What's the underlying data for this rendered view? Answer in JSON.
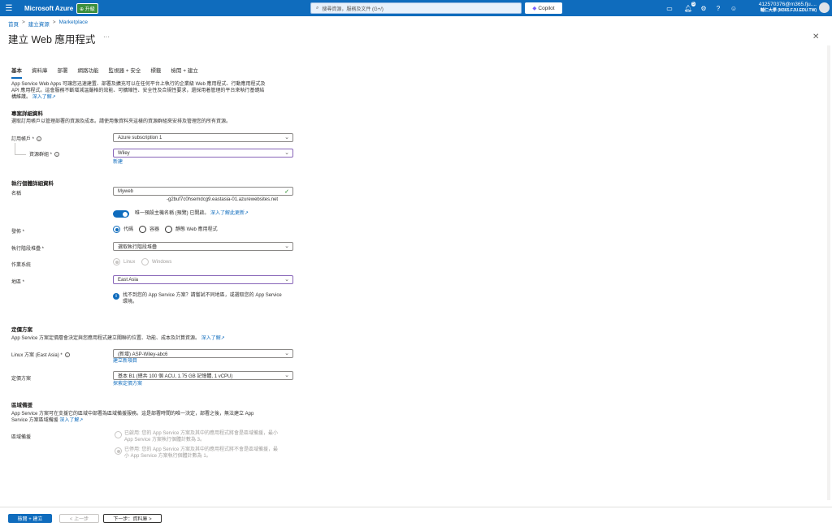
{
  "topbar": {
    "brand": "Microsoft Azure",
    "upgrade": "升級",
    "search_placeholder": "搜尋資源，服務及文件 (G+/)",
    "copilot": "Copilot",
    "notification_count": "5",
    "user_name": "412570376@m365.fju....",
    "user_org": "輔仁大學 (M365.FJU.EDU.TW)"
  },
  "breadcrumb": [
    "首頁",
    "建立資源",
    "Marketplace"
  ],
  "page": {
    "title": "建立 Web 應用程式",
    "more": "···"
  },
  "tabs": [
    "基本",
    "資料庫",
    "部署",
    "網路功能",
    "監視器 + 安全",
    "標籤",
    "檢閱 + 建立"
  ],
  "intro": {
    "line1": "App Service Web Apps 可讓您迅速建置、部署及擴充可以在任何平台上執行的企業級 Web 應用程式、行動應用程式及",
    "line2": "API 應用程式。這會服務不斷增減溫嚴格的效能、可擴縮性、安全性及合規性要求，還採用着管理的平台來執行基礎結",
    "line3": "構維護。",
    "link": "深入了解"
  },
  "project": {
    "heading": "專案詳細資料",
    "desc": "選取訂用帳戶以管理部署的資源及成本。請使用像資料夾這樣的資源群組來安排及管理您的所有資源。",
    "subscription_label": "訂用帳戶 *",
    "subscription_value": "Azure subscription 1",
    "rg_label": "資源群組 *",
    "rg_value": "Wiley",
    "rg_new": "新建"
  },
  "instance": {
    "heading": "執行個體詳細資料",
    "name_label": "名稱",
    "name_value": "Myweb",
    "domain_suffix": "-g2buf7c0hsemdcg9.eastasia-01.azurewebsites.net",
    "unique_host_text": "唯一預設主機名稱 (預覽) 已開啟。",
    "unique_host_link": "深入了解此更新",
    "publish_label": "發佈 *",
    "publish_options": [
      "代碼",
      "容器",
      "靜態 Web 應用程式"
    ],
    "runtime_label": "執行階段堆疊 *",
    "runtime_value": "選取執行階段堆疊",
    "os_label": "作業系統",
    "os_options": [
      "Linux",
      "Windows"
    ],
    "region_label": "地區 *",
    "region_value": "East Asia",
    "region_info_1": "找不到您的 App Service 方案？請嘗試不同地區，或選取您的 App Service",
    "region_info_2": "環境。"
  },
  "pricing": {
    "heading": "定價方案",
    "desc": "App Service 方案定價層會決定與您應用程式建立關聯的位置、功能、成本及計算資源。",
    "desc_link": "深入了解",
    "plan_label": "Linux 方案 (East Asia) *",
    "plan_value": "(新增) ASP-Wiley-abc6",
    "plan_new": "建立新項目",
    "tier_label": "定價方案",
    "tier_value": "基本 B1 (總共 100 個 ACU, 1.75 GB 記憶體, 1 vCPU)",
    "tier_link": "探索定價方案"
  },
  "zone": {
    "heading": "區域備援",
    "desc_1": "App Service 方案可在支援它的區域中部署為區域備援服務。這是部署時間的唯一決定，部署之後，無法建立 App",
    "desc_2": "Service 方案區域備援",
    "desc_link": "深入了解",
    "label": "區域備援",
    "opt1_a": "已啟用: 您的 App Service 方案及其中的應用程式將會是區域備援，最小",
    "opt1_b": "App Service 方案執行個體計數為 3。",
    "opt2_a": "已停用: 您的 App Service 方案及其中的應用程式將不會是區域備援，最",
    "opt2_b": "小 App Service 方案執行個體計數為 1。"
  },
  "footer": {
    "review": "檢閱 + 建立",
    "prev": "< 上一步",
    "next": "下一步：資料庫 >"
  }
}
